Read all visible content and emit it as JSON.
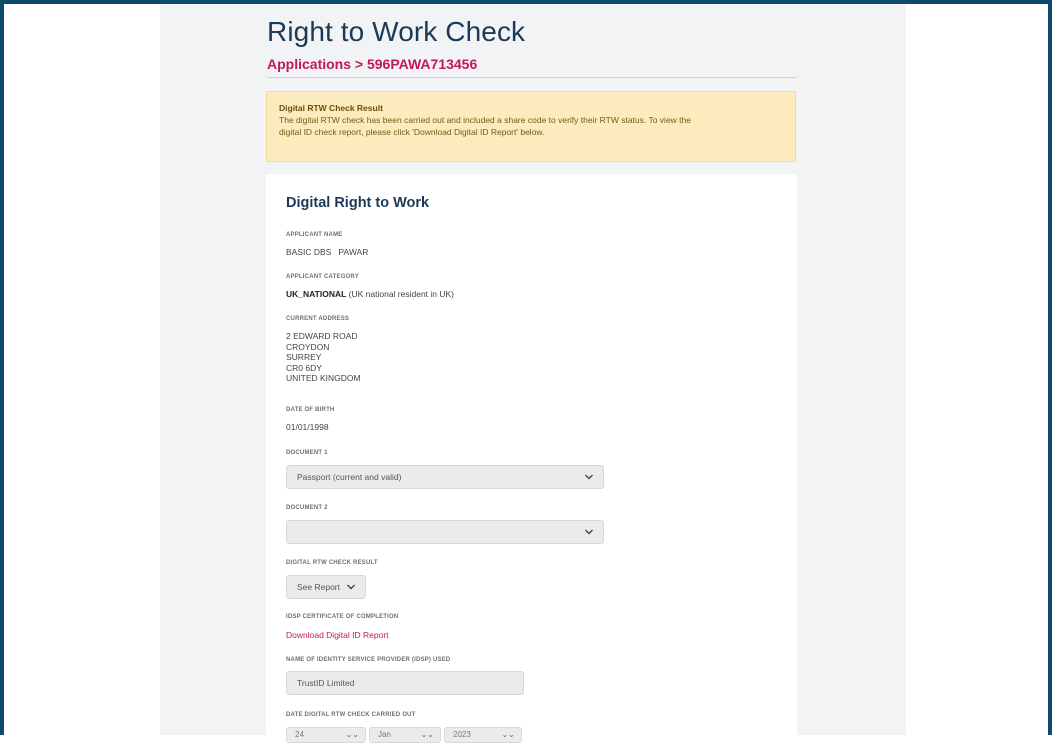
{
  "header": {
    "title": "Right to Work Check",
    "breadcrumb_root": "Applications",
    "breadcrumb_separator": ">",
    "breadcrumb_current": "596PAWA713456"
  },
  "alert": {
    "title": "Digital RTW Check Result",
    "line1": "The digital RTW check has been carried out and included a share code to verify their RTW status. To view the",
    "line2": "digital ID check report, please click 'Download Digital ID Report' below."
  },
  "card": {
    "title": "Digital Right to Work",
    "applicant_name": {
      "label": "APPLICANT NAME",
      "value": "BASIC DBS   PAWAR"
    },
    "applicant_category": {
      "label": "APPLICANT CATEGORY",
      "code": "UK_NATIONAL",
      "desc": " (UK national resident in UK)"
    },
    "current_address": {
      "label": "CURRENT ADDRESS",
      "lines": [
        "2 EDWARD ROAD",
        "CROYDON",
        "SURREY",
        "CR0 6DY",
        "UNITED KINGDOM"
      ]
    },
    "date_of_birth": {
      "label": "DATE OF BIRTH",
      "value": "01/01/1998"
    },
    "document1": {
      "label": "DOCUMENT 1",
      "selected": "Passport (current and valid)"
    },
    "document2": {
      "label": "DOCUMENT 2",
      "selected": ""
    },
    "rtw_result": {
      "label": "DIGITAL RTW CHECK RESULT",
      "selected": "See Report"
    },
    "idsp_certificate": {
      "label": "IDSP CERTIFICATE OF COMPLETION",
      "link": "Download Digital ID Report"
    },
    "idsp_name": {
      "label": "NAME OF IDENTITY SERVICE PROVIDER (IDSP) USED",
      "value": "TrustID Limited"
    },
    "check_date": {
      "label": "DATE DIGITAL RTW CHECK CARRIED OUT",
      "day": "24",
      "month": "Jan",
      "year": "2023"
    }
  },
  "colors": {
    "frame": "#0e4a6a",
    "title": "#1c3a57",
    "accent": "#c2185b",
    "alert_bg": "#fcebbd",
    "page_bg": "#f1f3f4"
  },
  "icons": {
    "dropdown": "chevron-down-icon"
  }
}
